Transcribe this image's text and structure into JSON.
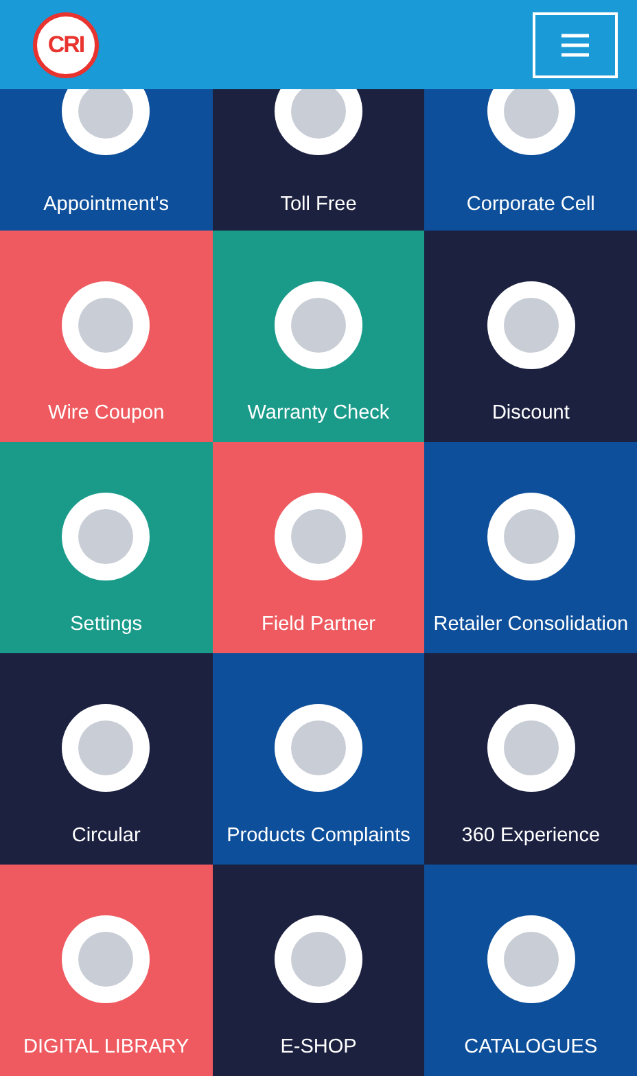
{
  "header": {
    "logo": "CRI"
  },
  "tiles": [
    {
      "label": "Appointment's",
      "color": "#0d4f9a"
    },
    {
      "label": "Toll Free",
      "color": "#1c2140"
    },
    {
      "label": "Corporate Cell",
      "color": "#0d4f9a"
    },
    {
      "label": "Wire Coupon",
      "color": "#ee5a5f"
    },
    {
      "label": "Warranty Check",
      "color": "#1a9b8a"
    },
    {
      "label": "Discount",
      "color": "#1c2140"
    },
    {
      "label": "Settings",
      "color": "#1a9b8a"
    },
    {
      "label": "Field Partner",
      "color": "#ee5a5f"
    },
    {
      "label": "Retailer Consolidation",
      "color": "#0d4f9a"
    },
    {
      "label": "Circular",
      "color": "#1c2140"
    },
    {
      "label": "Products Complaints",
      "color": "#0d4f9a"
    },
    {
      "label": "360 Experience",
      "color": "#1c2140"
    },
    {
      "label": "DIGITAL LIBRARY",
      "color": "#ee5a5f"
    },
    {
      "label": "E-SHOP",
      "color": "#1c2140"
    },
    {
      "label": "CATALOGUES",
      "color": "#0d4f9a"
    }
  ]
}
